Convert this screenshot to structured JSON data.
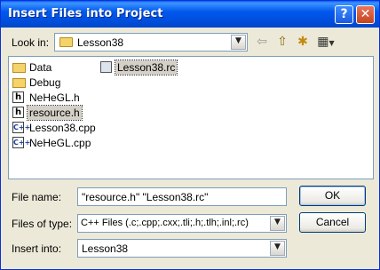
{
  "window": {
    "title": "Insert Files into Project",
    "help_glyph": "?",
    "close_glyph": "✕"
  },
  "lookin": {
    "label": "Look in:",
    "value": "Lesson38",
    "arrow": "▼"
  },
  "toolbar": {
    "back": "⇦",
    "up": "⇧",
    "new_folder": "✱",
    "view": "▦"
  },
  "files": [
    {
      "name": "Data",
      "type": "folder"
    },
    {
      "name": "Debug",
      "type": "folder"
    },
    {
      "name": "NeHeGL.h",
      "type": "h",
      "glyph": "h"
    },
    {
      "name": "resource.h",
      "type": "h",
      "glyph": "h",
      "state": "focused"
    },
    {
      "name": "Lesson38.cpp",
      "type": "cpp",
      "glyph": "C++"
    },
    {
      "name": "NeHeGL.cpp",
      "type": "cpp",
      "glyph": "C++"
    },
    {
      "name": "Lesson38.rc",
      "type": "rc",
      "state": "selected"
    }
  ],
  "filename": {
    "label": "File name:",
    "value": "\"resource.h\" \"Lesson38.rc\""
  },
  "filetype": {
    "label": "Files of type:",
    "value": "C++ Files (.c;.cpp;.cxx;.tli;.h;.tlh;.inl;.rc)",
    "arrow": "▼"
  },
  "insertinto": {
    "label": "Insert into:",
    "value": "Lesson38",
    "arrow": "▼"
  },
  "buttons": {
    "ok": "OK",
    "cancel": "Cancel"
  }
}
